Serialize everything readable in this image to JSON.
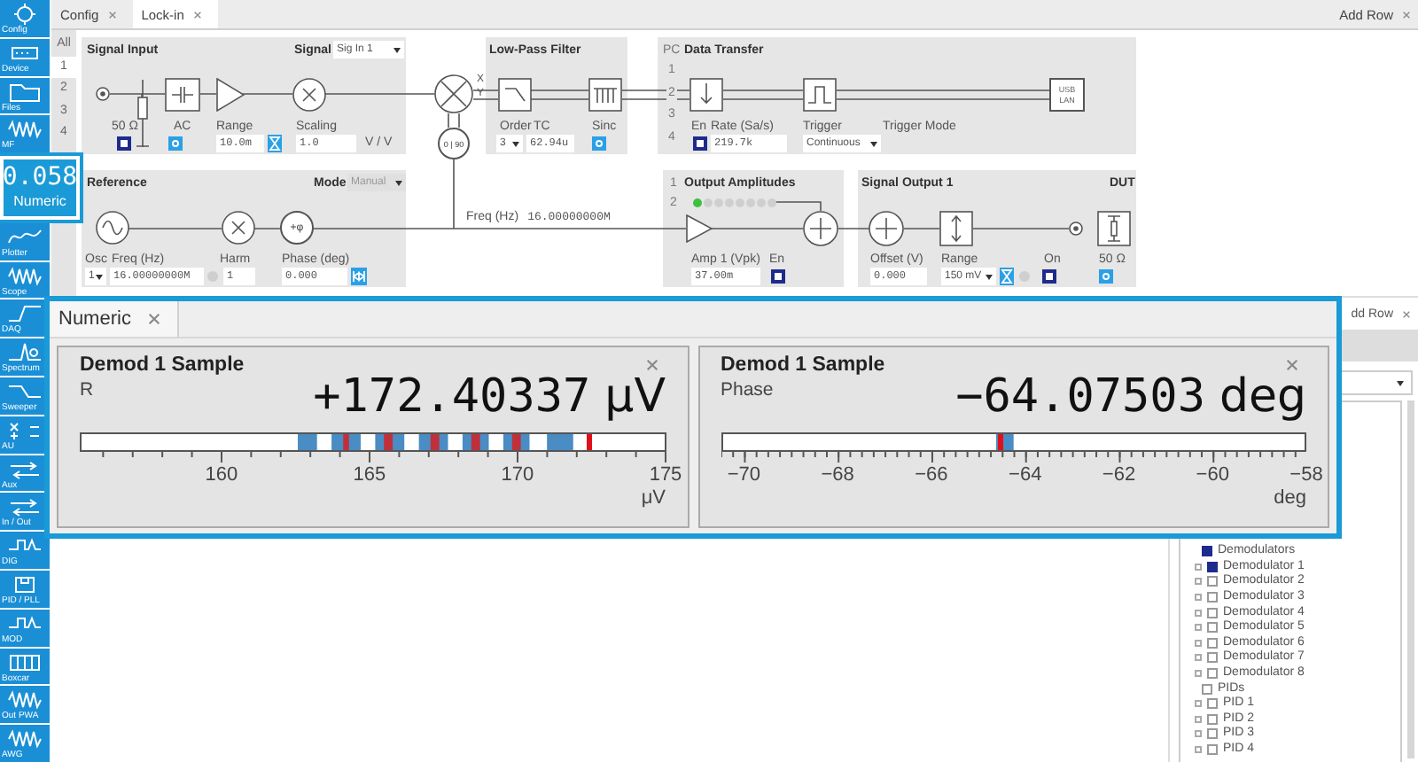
{
  "sidebar": {
    "items": [
      {
        "label": "Config",
        "selected": false
      },
      {
        "label": "Device",
        "selected": false
      },
      {
        "label": "Files",
        "selected": false
      },
      {
        "label": "MF",
        "selected": false
      },
      {
        "label": "Numeric",
        "value": "0.058",
        "selected": true
      },
      {
        "label": "Plotter",
        "selected": false
      },
      {
        "label": "Scope",
        "selected": false
      },
      {
        "label": "DAQ",
        "selected": false
      },
      {
        "label": "Spectrum",
        "selected": false
      },
      {
        "label": "Sweeper",
        "selected": false
      },
      {
        "label": "AU",
        "selected": false
      },
      {
        "label": "Aux",
        "selected": false
      },
      {
        "label": "In / Out",
        "selected": false
      },
      {
        "label": "DIG",
        "selected": false
      },
      {
        "label": "PID / PLL",
        "selected": false
      },
      {
        "label": "MOD",
        "selected": false
      },
      {
        "label": "Boxcar",
        "selected": false
      },
      {
        "label": "Out PWA",
        "selected": false
      },
      {
        "label": "AWG",
        "selected": false
      }
    ]
  },
  "tabs": [
    {
      "label": "Config",
      "selected": false
    },
    {
      "label": "Lock-in",
      "selected": true
    }
  ],
  "add_row": "Add Row",
  "lockin": {
    "rows": [
      {
        "label": "All",
        "selected": false
      },
      {
        "label": "1",
        "selected": true
      },
      {
        "label": "2",
        "selected": false
      },
      {
        "label": "3",
        "selected": false
      },
      {
        "label": "4",
        "selected": false
      }
    ],
    "signal_input": {
      "title": "Signal Input",
      "signal_label": "Signal",
      "signal_value": "Sig In 1",
      "impedance": "50 Ω",
      "impedance_on": true,
      "ac_label": "AC",
      "ac_on": false,
      "range_label": "Range",
      "range_value": "10.0m",
      "scaling_label": "Scaling",
      "scaling_value": "1.0",
      "scaling_unit": "V / V"
    },
    "mixer": {
      "x_label": "X",
      "y_label": "Y",
      "quadrature": "0 | 90"
    },
    "low_pass": {
      "title": "Low-Pass Filter",
      "order_label": "Order",
      "tc_label": "TC",
      "order_value": "3",
      "tc_value": "62.94u",
      "sinc_label": "Sinc",
      "sinc_on": false
    },
    "data_transfer": {
      "title": "Data Transfer",
      "pc_label": "PC",
      "channels": [
        "1",
        "2",
        "3",
        "4"
      ],
      "en_label": "En",
      "en_on": true,
      "rate_label": "Rate (Sa/s)",
      "rate_value": "219.7k",
      "trigger_label": "Trigger",
      "trigger_value": "Continuous",
      "trigger_mode_label": "Trigger Mode",
      "interface": [
        "USB",
        "LAN"
      ]
    },
    "reference": {
      "title": "Reference",
      "mode_label": "Mode",
      "mode_value": "Manual",
      "osc_label": "Osc",
      "osc_value": "1",
      "freq_label": "Freq (Hz)",
      "freq_value": "16.00000000M",
      "harm_label": "Harm",
      "harm_value": "1",
      "phase_symbol": "+φ",
      "phase_label": "Phase (deg)",
      "phase_value": "0.000"
    },
    "freq_readout": {
      "label": "Freq (Hz)",
      "value": "16.00000000M"
    },
    "output_amplitudes": {
      "title": "Output Amplitudes",
      "channels": [
        "1",
        "2"
      ],
      "oscillators": [
        {
          "on": true
        },
        {
          "on": false
        },
        {
          "on": false
        },
        {
          "on": false
        },
        {
          "on": false
        },
        {
          "on": false
        },
        {
          "on": false
        },
        {
          "on": false
        }
      ],
      "amp_label": "Amp 1 (Vpk)",
      "amp_value": "37.00m",
      "en_label": "En",
      "en_on": true
    },
    "signal_output": {
      "title": "Signal Output 1",
      "offset_label": "Offset (V)",
      "offset_value": "0.000",
      "range_label": "Range",
      "range_value": "150 mV",
      "on_label": "On",
      "on": true
    },
    "dut": {
      "title": "DUT",
      "impedance": "50 Ω",
      "impedance_on": false
    }
  },
  "numeric": {
    "tab": "Numeric",
    "cards": [
      {
        "title": "Demod 1 Sample",
        "signal": "R",
        "value": "+172.40337",
        "unit": "μV",
        "level": 0.87,
        "ticks": [
          "160",
          "165",
          "170",
          "175"
        ],
        "axis_unit": "μV"
      },
      {
        "title": "Demod 1 Sample",
        "signal": "Phase",
        "value": "−64.07503",
        "unit": "deg",
        "level": 0.475,
        "ticks": [
          "−70",
          "−68",
          "−66",
          "−64",
          "−62",
          "−60",
          "−58"
        ],
        "axis_unit": "deg"
      }
    ]
  },
  "side_panel": {
    "tab": "dd Row",
    "tree": [
      {
        "label": "Demodulators",
        "checked": true,
        "children": [
          {
            "label": "Demodulator 1",
            "checked": true
          },
          {
            "label": "Demodulator 2",
            "checked": false
          },
          {
            "label": "Demodulator 3",
            "checked": false
          },
          {
            "label": "Demodulator 4",
            "checked": false
          },
          {
            "label": "Demodulator 5",
            "checked": false
          },
          {
            "label": "Demodulator 6",
            "checked": false
          },
          {
            "label": "Demodulator 7",
            "checked": false
          },
          {
            "label": "Demodulator 8",
            "checked": false
          }
        ]
      },
      {
        "label": "PIDs",
        "checked": false,
        "children": [
          {
            "label": "PID 1",
            "checked": false
          },
          {
            "label": "PID 2",
            "checked": false
          },
          {
            "label": "PID 3",
            "checked": false
          },
          {
            "label": "PID 4",
            "checked": false
          }
        ]
      }
    ]
  }
}
